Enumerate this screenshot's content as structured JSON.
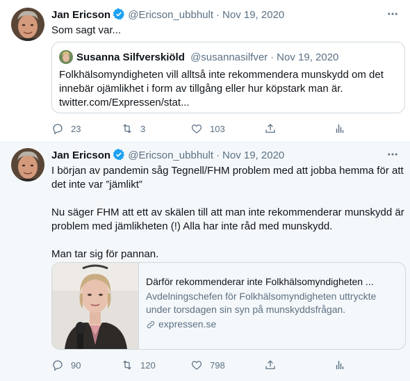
{
  "tweets": [
    {
      "author": {
        "name": "Jan Ericson",
        "handle": "@Ericson_ubbhult",
        "avatar": "avatar-jan-ericson",
        "verified": true
      },
      "date": "Nov 19, 2020",
      "text": "Som sagt var...",
      "quoted": {
        "author": {
          "name": "Susanna Silfverskiöld",
          "handle": "@susannasilfver",
          "avatar": "avatar-susanna"
        },
        "date": "Nov 19, 2020",
        "text": "Folkhälsomyndigheten vill alltså inte rekommendera munskydd om det innebär ojämlikhet i form av tillgång eller hur köpstark man är. twitter.com/Expressen/stat..."
      },
      "actions": {
        "reply": "23",
        "retweet": "3",
        "like": "103"
      }
    },
    {
      "author": {
        "name": "Jan Ericson",
        "handle": "@Ericson_ubbhult",
        "avatar": "avatar-jan-ericson",
        "verified": true
      },
      "date": "Nov 19, 2020",
      "paragraphs": [
        "I början av pandemin såg Tegnell/FHM problem med att jobba hemma för att det inte var ”jämlikt”",
        "Nu säger FHM att ett av skälen till att man inte rekommenderar munskydd är problem med jämlikheten (!) Alla har inte råd med munskydd.",
        "Man tar sig för pannan."
      ],
      "card": {
        "title": "Därför rekommenderar inte Folkhälsomyndigheten ...",
        "description": "Avdelningschefen för Folkhälsomyndigheten uttryckte under torsdagen sin syn på munskyddsfrågan.",
        "domain": "expressen.se",
        "image": "photo-woman-speaking-at-microphone"
      },
      "actions": {
        "reply": "90",
        "retweet": "120",
        "like": "798"
      }
    }
  ],
  "colors": {
    "verified": "#1da1f2",
    "secondary_text": "#5b7083",
    "border": "#cfd9de",
    "highlight_bg": "#f5f8fa"
  },
  "icons": [
    "verified-badge-icon",
    "more-icon",
    "reply-icon",
    "retweet-icon",
    "like-icon",
    "share-icon",
    "analytics-icon",
    "link-icon"
  ]
}
